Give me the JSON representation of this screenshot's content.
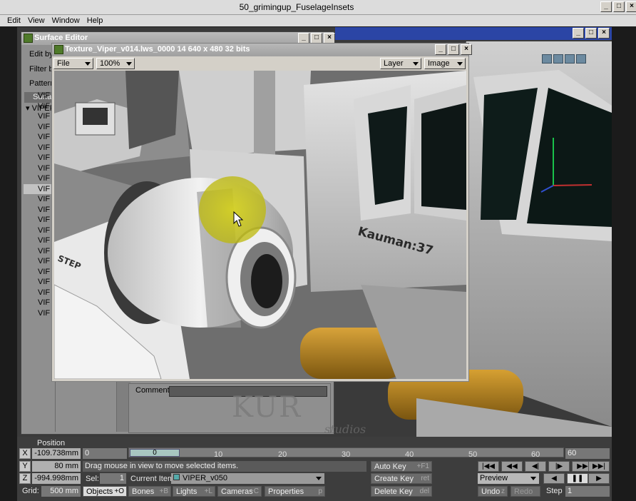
{
  "app": {
    "title": "50_grimingup_FuselageInsets",
    "menu": [
      "Edit",
      "View",
      "Window",
      "Help"
    ]
  },
  "surface_editor": {
    "title": "Surface Editor",
    "edit_by": "Edit by",
    "filter_by": "Filter by",
    "pattern": "Pattern",
    "list_header": "Surfa",
    "root": "VIPER",
    "items": [
      "VIF",
      "VIF",
      "VIF",
      "VIF",
      "VIF",
      "VIF",
      "VIF",
      "VIF",
      "VIF",
      "VIF",
      "VIF",
      "VIF",
      "VIF",
      "VIF",
      "VIF",
      "VIF",
      "VIF",
      "VIF",
      "VIF",
      "VIF",
      "VIF",
      "VIF"
    ],
    "comment_label": "Comment",
    "comment_value": ""
  },
  "texture_window": {
    "title": "Texture_Viper_v014.lws_0000 14  640 x 480 32 bits",
    "file_menu": "File",
    "zoom": "100%",
    "layer": "Layer",
    "image": "Image",
    "hull_text": "Kauman:37",
    "step_text": "STEP"
  },
  "watermark": {
    "main": "KUR",
    "sub": "studios"
  },
  "bottom": {
    "position_label": "Position",
    "x_label": "X",
    "x_value": "-109.738mm",
    "y_label": "Y",
    "y_value": "80 mm",
    "z_label": "Z",
    "z_value": "-994.998mm",
    "grid_label": "Grid:",
    "grid_value": "500 mm",
    "frame_start": "0",
    "frame_end": "60",
    "current_frame": "0",
    "ticks": [
      "10",
      "20",
      "30",
      "40",
      "50",
      "60"
    ],
    "hint": "Drag mouse in view to move selected items.",
    "sel_label": "Sel:",
    "sel_value": "1",
    "current_item_label": "Current Item",
    "current_item_value": "VIPER_v050",
    "objects": "Objects",
    "objects_key": "+O",
    "bones": "Bones",
    "bones_key": "+B",
    "lights": "Lights",
    "lights_key": "+L",
    "cameras": "Cameras",
    "cameras_key": "+C",
    "properties": "Properties",
    "properties_key": "p",
    "auto_key": "Auto Key",
    "auto_key_key": "+F1",
    "create_key": "Create Key",
    "create_key_key": "ret",
    "delete_key": "Delete Key",
    "delete_key_key": "del",
    "preview": "Preview",
    "undo": "Undo",
    "undo_key": "z",
    "redo": "Redo",
    "step_label": "Step",
    "step_value": "1"
  }
}
